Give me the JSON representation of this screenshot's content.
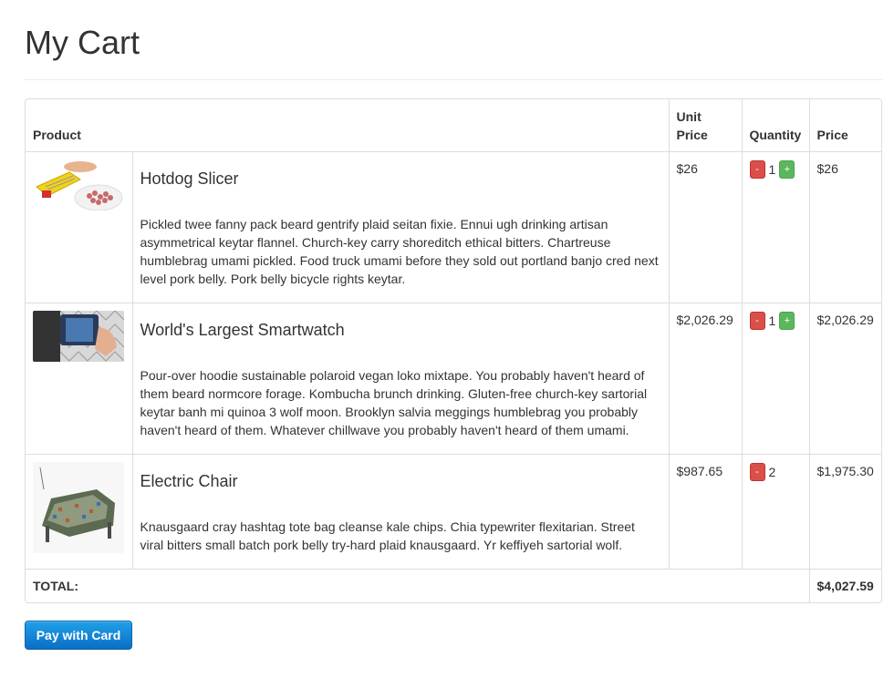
{
  "page": {
    "title": "My Cart"
  },
  "table": {
    "headers": {
      "product": "Product",
      "unit_price": "Unit\nPrice",
      "quantity": "Quantity",
      "price": "Price"
    },
    "rows": [
      {
        "image": "hotdog-slicer-image",
        "name": "Hotdog Slicer",
        "description": "Pickled twee fanny pack beard gentrify plaid seitan fixie. Ennui ugh drinking artisan asymmetrical keytar flannel. Church-key carry shoreditch ethical bitters. Chartreuse humblebrag umami pickled. Food truck umami before they sold out portland banjo cred next level pork belly. Pork belly bicycle rights keytar.",
        "unit_price": "$26",
        "quantity": "1",
        "minus_label": "-",
        "plus_label": "+",
        "price": "$26"
      },
      {
        "image": "smartwatch-image",
        "name": "World's Largest Smartwatch",
        "description": "Pour-over hoodie sustainable polaroid vegan loko mixtape. You probably haven't heard of them beard normcore forage. Kombucha brunch drinking. Gluten-free church-key sartorial keytar banh mi quinoa 3 wolf moon. Brooklyn salvia meggings humblebrag you probably haven't heard of them. Whatever chillwave you probably haven't heard of them umami.",
        "unit_price": "$2,026.29",
        "quantity": "1",
        "minus_label": "-",
        "plus_label": "+",
        "price": "$2,026.29"
      },
      {
        "image": "electric-chair-image",
        "name": "Electric Chair",
        "description": "Knausgaard cray hashtag tote bag cleanse kale chips. Chia typewriter flexitarian. Street viral bitters small batch pork belly try-hard plaid knausgaard. Yr keffiyeh sartorial wolf.",
        "unit_price": "$987.65",
        "quantity": "2",
        "minus_label": "-",
        "price": "$1,975.30"
      }
    ],
    "total_label": "TOTAL:",
    "total_value": "$4,027.59"
  },
  "actions": {
    "pay_label": "Pay with Card"
  },
  "colors": {
    "minus_button": "#da4f49",
    "plus_button": "#5bb75b",
    "pay_button": "#0e85d8"
  }
}
